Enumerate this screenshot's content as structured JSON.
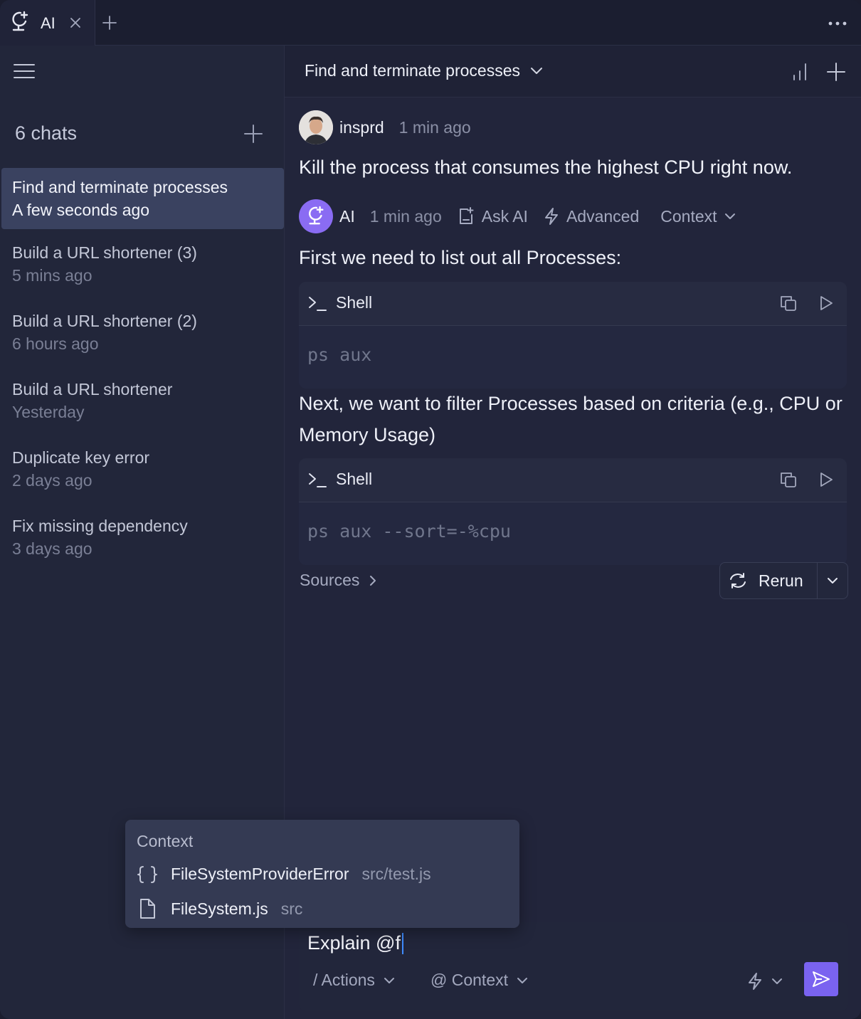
{
  "tabbar": {
    "tab_label": "AI",
    "tab_icon": "ai-logo-icon"
  },
  "sidebar": {
    "chats_count": "6 chats",
    "items": [
      {
        "title": "Find and terminate processes",
        "time": "A few seconds ago",
        "active": true
      },
      {
        "title": "Build a URL shortener (3)",
        "time": "5 mins ago",
        "active": false
      },
      {
        "title": "Build a URL shortener (2)",
        "time": "6 hours ago",
        "active": false
      },
      {
        "title": "Build a URL shortener",
        "time": "Yesterday",
        "active": false
      },
      {
        "title": "Duplicate key error",
        "time": "2 days ago",
        "active": false
      },
      {
        "title": "Fix missing dependency",
        "time": "3 days ago",
        "active": false
      }
    ]
  },
  "header": {
    "chat_title": "Find and terminate processes"
  },
  "conversation": {
    "user": {
      "name": "insprd",
      "time": "1 min ago",
      "text": "Kill the process that consumes the highest CPU right now."
    },
    "ai": {
      "name": "AI",
      "time": "1 min ago",
      "actions": {
        "ask_ai": "Ask AI",
        "advanced": "Advanced",
        "context": "Context"
      },
      "para1": "First we need to list out all Processes:",
      "code1": {
        "lang": "Shell",
        "code": "ps aux"
      },
      "para2": "Next, we want to filter Processes based on criteria (e.g., CPU or Memory Usage)",
      "code2": {
        "lang": "Shell",
        "code": "ps aux --sort=-%cpu"
      },
      "sources_label": "Sources",
      "rerun_label": "Rerun"
    }
  },
  "context_popup": {
    "title": "Context",
    "items": [
      {
        "icon": "braces-icon",
        "name": "FileSystemProviderError",
        "path": "src/test.js"
      },
      {
        "icon": "file-icon",
        "name": "FileSystem.js",
        "path": "src"
      }
    ]
  },
  "composer": {
    "text": "Explain @f",
    "actions_label": "/ Actions",
    "context_label": "@ Context"
  },
  "colors": {
    "accent": "#7a63f0",
    "ai_avatar": "#8a6cf3",
    "caret": "#3f8cff",
    "active_chat_bg": "#3a4260"
  }
}
